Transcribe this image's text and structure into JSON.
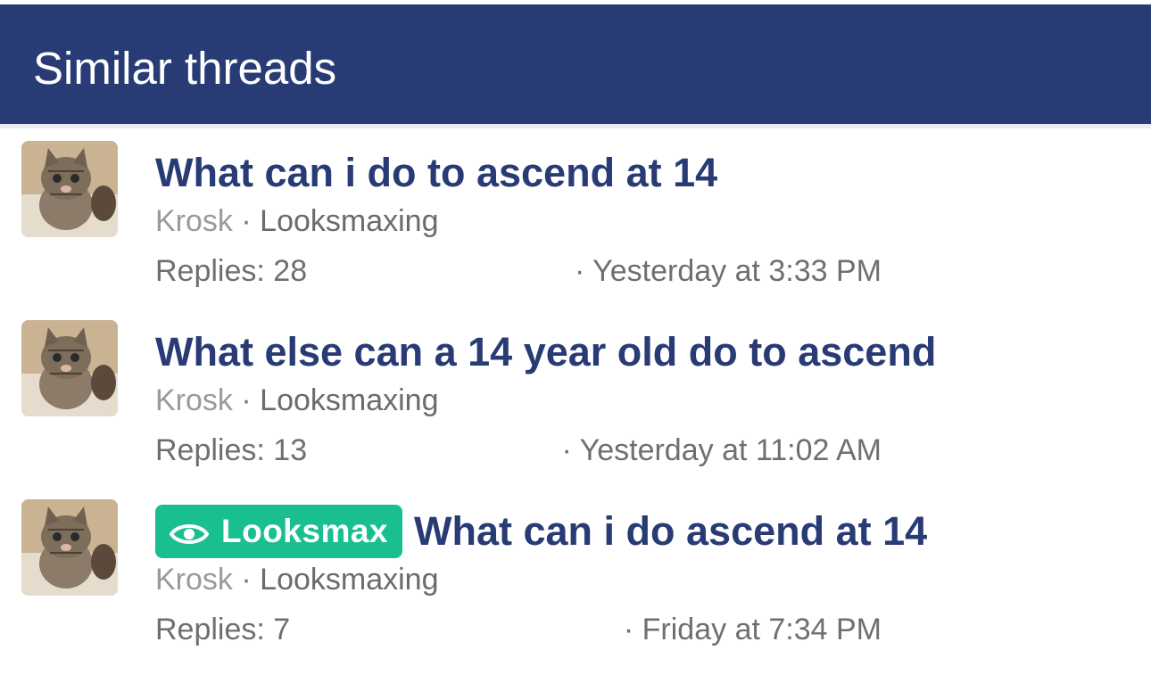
{
  "header": {
    "title": "Similar threads"
  },
  "colors": {
    "header_bg": "#283b75",
    "title_text": "#283b75",
    "prefix_bg": "#19bf91"
  },
  "threads": [
    {
      "title": "What can i do to ascend at 14",
      "author": "Krosk",
      "separator": "·",
      "forum": "Looksmaxing",
      "replies": "Replies: 28",
      "date": "· Yesterday at 3:33 PM"
    },
    {
      "title": "What else can a 14 year old do to ascend",
      "author": "Krosk",
      "separator": "·",
      "forum": "Looksmaxing",
      "replies": "Replies: 13",
      "date": "· Yesterday at 11:02 AM"
    },
    {
      "prefix": "Looksmax",
      "prefix_icon": "eye-icon",
      "title": "What can i do ascend at 14",
      "author": "Krosk",
      "separator": "·",
      "forum": "Looksmaxing",
      "replies": "Replies: 7",
      "date": "· Friday at 7:34 PM"
    }
  ]
}
